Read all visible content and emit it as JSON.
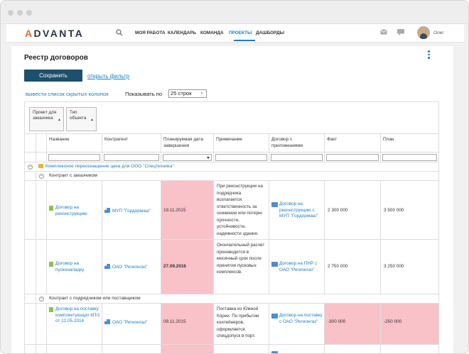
{
  "app": {
    "logo": "ADVANTA",
    "logo_accent": "A"
  },
  "nav": [
    {
      "label": "МОЯ РАБОТА"
    },
    {
      "label": "КАЛЕНДАРЬ"
    },
    {
      "label": "КОМАНДА"
    },
    {
      "label": "ПРОЕКТЫ"
    },
    {
      "label": "ДАШБОРДЫ"
    }
  ],
  "nav_active": "ПРОЕКТЫ",
  "user": {
    "name": "Олег"
  },
  "page": {
    "title": "Реестр договоров",
    "save_label": "Сохранить",
    "filter_link": "открыть фильтр",
    "hidden_cols_link": "вывести список скрытых колонок",
    "show_label": "Показывать по",
    "rows_selected": "25 строк"
  },
  "group_chips": [
    {
      "label": "Проект для заказчика"
    },
    {
      "label": "Тип объекта"
    }
  ],
  "columns": [
    "Название",
    "Контрагент",
    "Планируемая дата завершения",
    "Примечание",
    "Договор с приложениями",
    "Факт",
    "План"
  ],
  "project": "Комплексное переоснащение цеха для ООО \"Спецтехника\"",
  "groups": [
    {
      "label": "Контракт с заказчиком"
    },
    {
      "label": "Контракт с подрядчиком или поставщиком"
    }
  ],
  "rows": [
    {
      "name": "Договор на реконструкцию",
      "counterparty": "МУП \"Гордормаш\"",
      "date": "19.11.2015",
      "note": "При реконструкции на подрядчика возлагается ответственность за снижение или потерю прочности, устойчивости, надежности здания.",
      "contract": "Договор на реконструкцию с МУП \"Гордормаш\"",
      "fact": "2 300 000",
      "plan": "3 500 000"
    },
    {
      "name": "Договор на пусконаладку",
      "counterparty": "ОАО \"Регионгаз\"",
      "date": "27.09.2016",
      "note": "Окончательный расчет производится в месячный срок после принятия пусковых комплексов.",
      "contract": "Договор на ПНР с ОАО \"Регионгаз\"",
      "fact": "2 750 000",
      "plan": "3 250 000"
    },
    {
      "name": "Договор на поставку комплектующих КП/1 от 12.05.2014",
      "counterparty": "ОАО \"Регионгаз\"",
      "date": "09.11.2015",
      "note": "Поставка из Южной Кореи. По прибытии контейнеров, оформляется спецдопуск в порт.",
      "contract": "Договор на поставку с ОАО \"Регионгаз\"",
      "fact": "-300 000",
      "plan": "-250 000"
    }
  ],
  "colors": {
    "accent": "#1a7fc4",
    "save_button": "#1d4f6e",
    "overdue": "#f9c1c8",
    "logo_orange": "#e06a2b"
  },
  "icons": [
    "search-icon",
    "mail-icon",
    "chat-icon",
    "kebab-icon",
    "document-icon",
    "folder-icon",
    "organization-icon",
    "attachment-icon",
    "collapse-icon"
  ]
}
